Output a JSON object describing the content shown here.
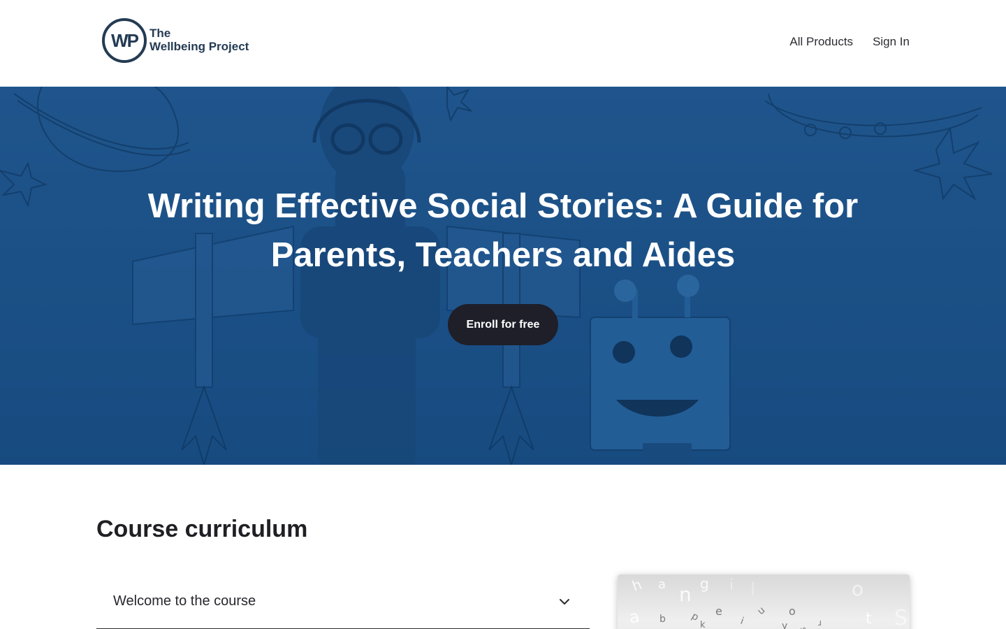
{
  "header": {
    "logo_mark": "WP",
    "logo_line1": "The",
    "logo_line2": "Wellbeing Project",
    "nav": [
      {
        "label": "All Products"
      },
      {
        "label": "Sign In"
      }
    ]
  },
  "hero": {
    "title": "Writing Effective Social Stories: A Guide for Parents, Teachers and Aides",
    "enroll_label": "Enroll for free"
  },
  "curriculum": {
    "title": "Course curriculum",
    "sections": [
      {
        "label": "Welcome to the course"
      }
    ]
  },
  "colors": {
    "hero_blue": "#1f5286",
    "button_dark": "#1e1f29",
    "logo_navy": "#243b53"
  },
  "icons": {
    "accordion": "chevron-down-icon"
  }
}
